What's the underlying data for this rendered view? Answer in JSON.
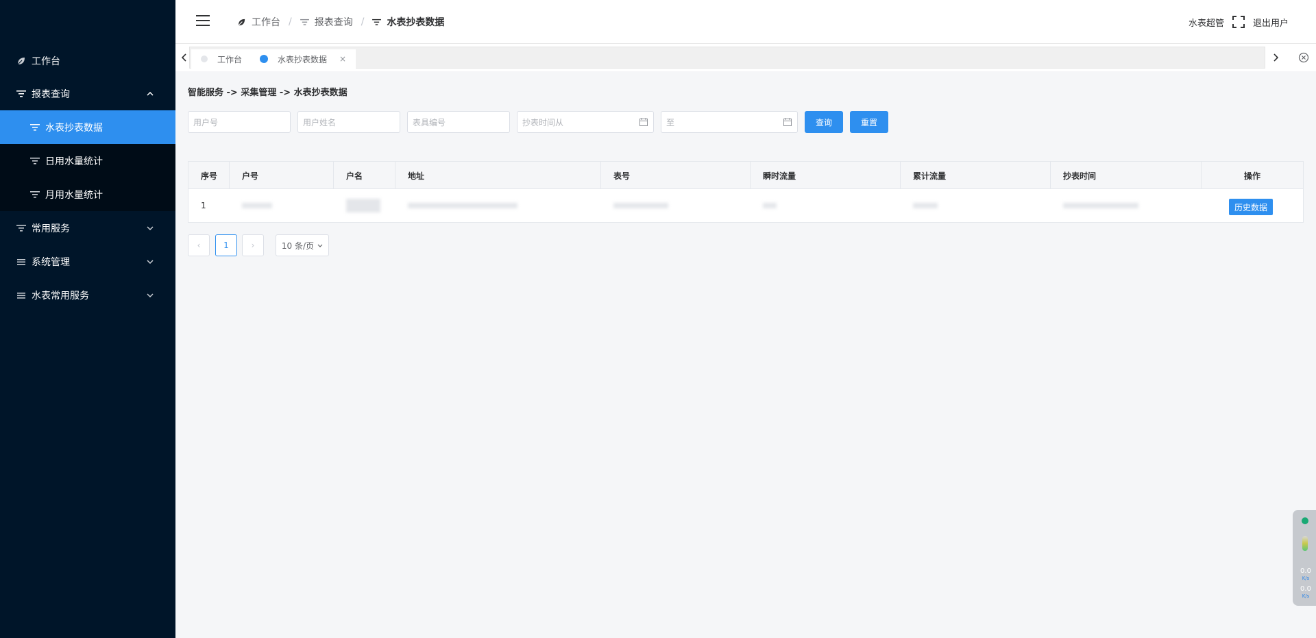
{
  "sidebar": {
    "items": [
      {
        "label": "工作台",
        "icon": "leaf-icon"
      },
      {
        "label": "报表查询",
        "icon": "filter-icon",
        "expanded": true
      },
      {
        "label": "水表抄表数据",
        "icon": "filter-icon",
        "active": true
      },
      {
        "label": "日用水量统计",
        "icon": "filter-icon"
      },
      {
        "label": "月用水量统计",
        "icon": "filter-icon"
      },
      {
        "label": "常用服务",
        "icon": "filter-icon"
      },
      {
        "label": "系统管理",
        "icon": "list-icon"
      },
      {
        "label": "水表常用服务",
        "icon": "list-icon"
      }
    ]
  },
  "header": {
    "breadcrumb": [
      "工作台",
      "报表查询",
      "水表抄表数据"
    ],
    "separator": "/",
    "username": "水表超管",
    "logout": "退出用户"
  },
  "tabs": [
    {
      "label": "工作台",
      "active": false
    },
    {
      "label": "水表抄表数据",
      "active": true,
      "close": "×"
    }
  ],
  "content": {
    "path_title": "智能服务 -> 采集管理 -> 水表抄表数据",
    "filters": {
      "user_no_placeholder": "用户号",
      "user_name_placeholder": "用户姓名",
      "meter_no_placeholder": "表具编号",
      "time_from_placeholder": "抄表时间从",
      "time_to_placeholder": "至"
    },
    "buttons": {
      "query": "查询",
      "reset": "重置"
    },
    "table": {
      "headers": [
        "序号",
        "户号",
        "户名",
        "地址",
        "表号",
        "瞬时流量",
        "累计流量",
        "抄表时间",
        "操作"
      ],
      "rows": [
        {
          "index": "1",
          "action": "历史数据"
        }
      ]
    },
    "pagination": {
      "prev": "‹",
      "current_page": "1",
      "next": "›",
      "page_size": "10 条/页"
    }
  },
  "widget": {
    "up_rate": "0.0",
    "up_unit": "K/s",
    "down_rate": "0.0",
    "down_unit": "K/s"
  },
  "colors": {
    "sidebar_bg": "#001529",
    "accent": "#2e8fef",
    "page_bg": "#f5f6f8"
  }
}
